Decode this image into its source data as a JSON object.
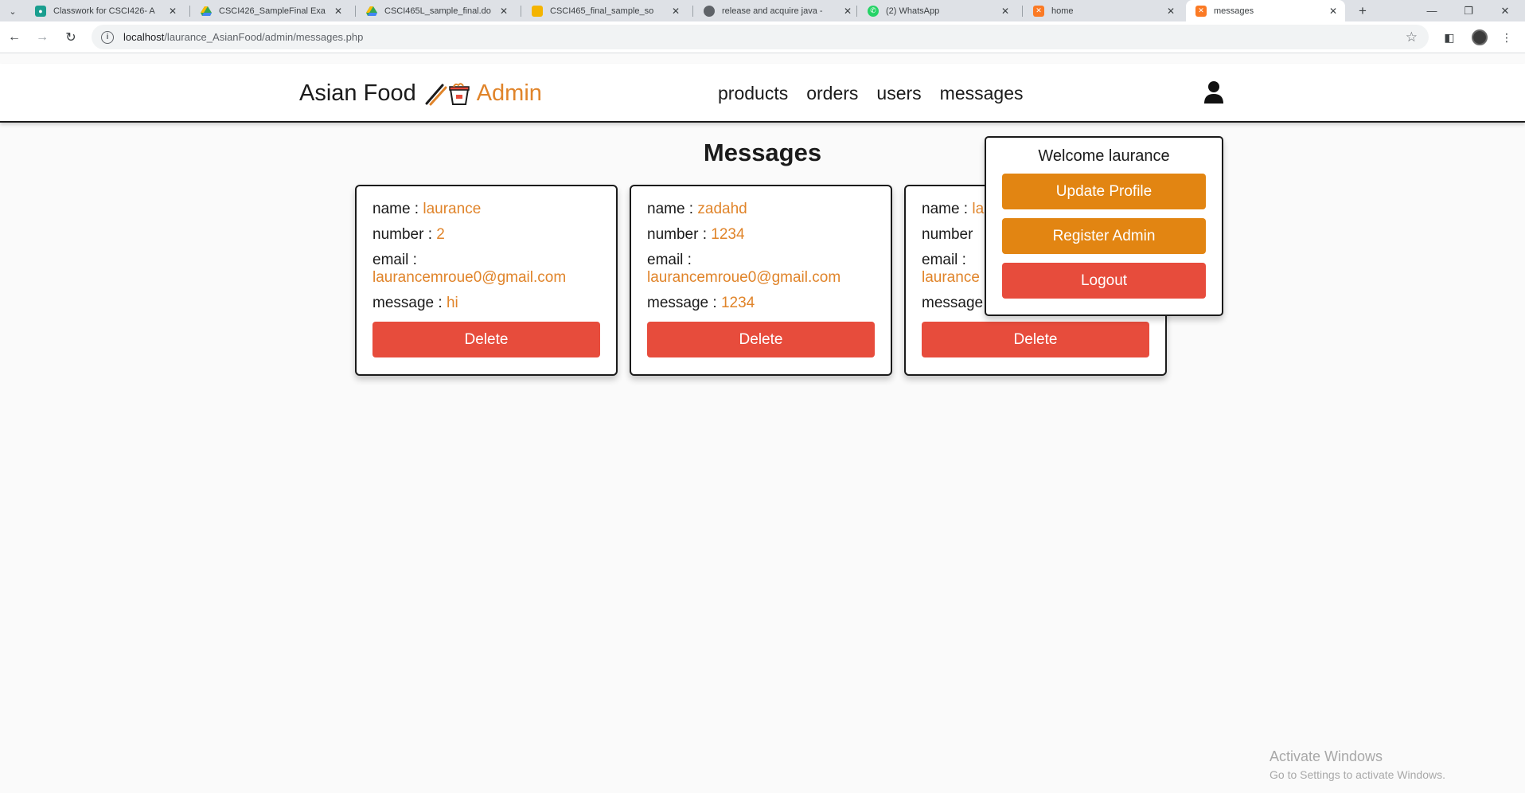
{
  "browser": {
    "tabs": [
      {
        "title": "Classwork for CSCI426- A",
        "favicon": "classroom-icon",
        "color": "#1a9e8f"
      },
      {
        "title": "CSCI426_SampleFinal Exa",
        "favicon": "drive-icon",
        "color": "#34a853"
      },
      {
        "title": "CSCI465L_sample_final.do",
        "favicon": "drive-icon",
        "color": "#34a853"
      },
      {
        "title": "CSCI465_final_sample_so",
        "favicon": "folder-icon",
        "color": "#f4b400"
      },
      {
        "title": "release and acquire java -",
        "favicon": "globe-icon",
        "color": "#5f6368"
      },
      {
        "title": "(2) WhatsApp",
        "favicon": "whatsapp-icon",
        "color": "#25d366"
      },
      {
        "title": "home",
        "favicon": "xampp-icon",
        "color": "#fb7a24"
      },
      {
        "title": "messages",
        "favicon": "xampp-icon",
        "color": "#fb7a24"
      }
    ],
    "active_tab_index": 7,
    "url_host": "localhost",
    "url_path": "/laurance_AsianFood/admin/messages.php"
  },
  "site": {
    "logo_text": "Asian Food",
    "logo_admin": "Admin",
    "nav": [
      "products",
      "orders",
      "users",
      "messages"
    ]
  },
  "page": {
    "title": "Messages"
  },
  "messages": [
    {
      "name_label": "name :",
      "name": "laurance",
      "number_label": "number :",
      "number": "2",
      "email_label": "email :",
      "email": "laurancemroue0@gmail.com",
      "message_label": "message :",
      "message": "hi",
      "delete_label": "Delete"
    },
    {
      "name_label": "name :",
      "name": "zadahd",
      "number_label": "number :",
      "number": "1234",
      "email_label": "email :",
      "email": "laurancemroue0@gmail.com",
      "message_label": "message :",
      "message": "1234",
      "delete_label": "Delete"
    },
    {
      "name_label": "name :",
      "name": "la",
      "number_label": "number",
      "number": "",
      "email_label": "email :",
      "email": "laurance",
      "message_label": "message",
      "message": "",
      "delete_label": "Delete"
    }
  ],
  "profile": {
    "welcome": "Welcome laurance",
    "update_label": "Update Profile",
    "register_label": "Register Admin",
    "logout_label": "Logout"
  },
  "watermark": {
    "line1": "Activate Windows",
    "line2": "Go to Settings to activate Windows."
  },
  "colors": {
    "accent": "#e0842a",
    "delete": "#e74c3c",
    "orange_button": "#e28512"
  }
}
